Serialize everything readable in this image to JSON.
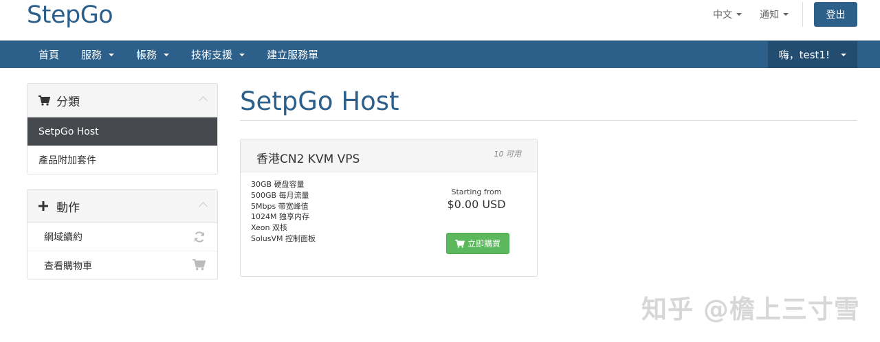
{
  "header": {
    "logo": "StepGo",
    "language_label": "中文",
    "notifications_label": "通知",
    "logout_label": "登出"
  },
  "nav": {
    "items": [
      {
        "label": "首頁",
        "dropdown": false
      },
      {
        "label": "服務",
        "dropdown": true
      },
      {
        "label": "帳務",
        "dropdown": true
      },
      {
        "label": "技術支援",
        "dropdown": true
      },
      {
        "label": "建立服務單",
        "dropdown": false
      }
    ],
    "user_label": "嗨，test1!"
  },
  "sidebar": {
    "categories": {
      "title": "分類",
      "icon": "cart-icon",
      "items": [
        {
          "label": "SetpGo Host",
          "active": true
        },
        {
          "label": "產品附加套件",
          "active": false
        }
      ]
    },
    "actions": {
      "title": "動作",
      "icon": "plus-icon",
      "items": [
        {
          "label": "網域續約",
          "icon": "refresh-icon"
        },
        {
          "label": "查看購物車",
          "icon": "cart-icon"
        }
      ]
    }
  },
  "main": {
    "title": "SetpGo Host",
    "product": {
      "name": "香港CN2 KVM VPS",
      "availability": "10 可用",
      "features": [
        "30GB 硬盘容量",
        "500GB 每月流量",
        "5Mbps 带宽峰值",
        "1024M 独享内存",
        "Xeon 双核",
        "SolusVM 控制面板"
      ],
      "starting_from": "Starting from",
      "price": "$0.00 USD",
      "order_label": "立即購買"
    }
  },
  "watermark": "知乎 @檐上三寸雪",
  "colors": {
    "brand": "#2c5f8a",
    "nav_bg": "#2c5f8a",
    "active_item": "#45494d",
    "order_button": "#5cb85c"
  }
}
